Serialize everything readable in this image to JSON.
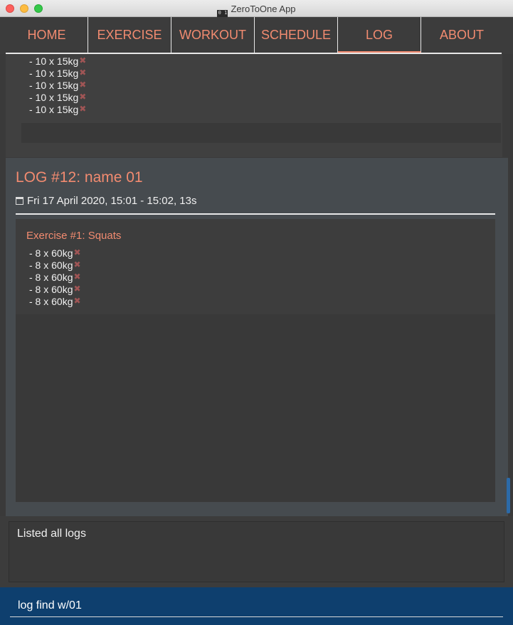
{
  "window": {
    "title": "ZeroToOne App",
    "icon_text": "0 1"
  },
  "tabs": [
    {
      "label": "HOME"
    },
    {
      "label": "EXERCISE"
    },
    {
      "label": "WORKOUT"
    },
    {
      "label": "SCHEDULE"
    },
    {
      "label": "LOG",
      "active": true
    },
    {
      "label": "ABOUT"
    }
  ],
  "previous_log": {
    "sets": [
      "- 10 x 15kg",
      "- 10 x 15kg",
      "- 10 x 15kg",
      "- 10 x 15kg",
      "- 10 x 15kg"
    ]
  },
  "log": {
    "title": "LOG #12: name 01",
    "date": "Fri 17 April 2020,  15:01 - 15:02, 13s",
    "exercise": {
      "title": "Exercise #1: Squats",
      "sets": [
        "- 8 x 60kg",
        "- 8 x 60kg",
        "- 8 x 60kg",
        "- 8 x 60kg",
        "- 8 x 60kg"
      ]
    }
  },
  "result": {
    "text": "Listed all logs"
  },
  "command": {
    "value": "log find w/01"
  },
  "icons": {
    "delete_set": "x-icon",
    "date": "calendar-icon"
  },
  "colors": {
    "accent": "#f28b70",
    "command_bg": "#0e3f6e",
    "card_bg": "#464b4f",
    "delete_mark": "#a05555"
  }
}
